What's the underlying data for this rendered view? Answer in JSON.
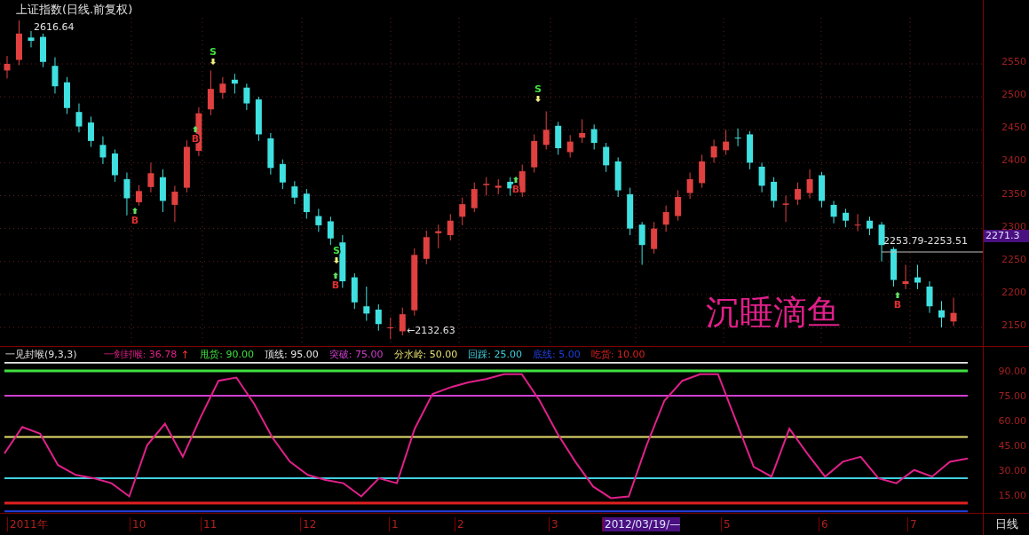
{
  "price_pane": {
    "title": "上证指数(日线.前复权)",
    "high_label": "2616.64",
    "low_label": "←2132.63",
    "range_label": "2253.79-2253.51",
    "signature": "沉睡滴鱼",
    "markers": [
      {
        "kind": "buy",
        "label": "B"
      },
      {
        "kind": "buy",
        "label": "B"
      },
      {
        "kind": "sell",
        "label": "S"
      },
      {
        "kind": "sell",
        "label": "S"
      },
      {
        "kind": "buy",
        "label": "B"
      },
      {
        "kind": "buy",
        "label": "B"
      },
      {
        "kind": "sell",
        "label": "S"
      },
      {
        "kind": "buy",
        "label": "B"
      }
    ],
    "current_price": "2271.3",
    "chart_data": {
      "type": "candlestick",
      "grid": true,
      "ylim": [
        2121.72,
        2646.97
      ],
      "categories": [
        null,
        null,
        null,
        null,
        null,
        null,
        null,
        null,
        null,
        null,
        null,
        null,
        null,
        null,
        null,
        null,
        null,
        null,
        null,
        null,
        null,
        null,
        null,
        null,
        null,
        null,
        null,
        null,
        null,
        null,
        null,
        null,
        null,
        null,
        null,
        null,
        null,
        null,
        null,
        null,
        null,
        null,
        null,
        null,
        null,
        null,
        null,
        null,
        null,
        null,
        null,
        null,
        null,
        null,
        null,
        null,
        null,
        null,
        null,
        null,
        null,
        null,
        null,
        null,
        null,
        null,
        null,
        null,
        null,
        null,
        null,
        null,
        null,
        null,
        null,
        null,
        null,
        null,
        null,
        null
      ],
      "yticks": [
        {
          "value": 2550,
          "label": "2550"
        },
        {
          "value": 2500,
          "label": "2500"
        },
        {
          "value": 2450,
          "label": "2450"
        },
        {
          "value": 2400,
          "label": "2400"
        },
        {
          "value": 2350,
          "label": "2350"
        },
        {
          "value": 2300,
          "label": "2300"
        },
        {
          "value": 2250,
          "label": "2250"
        },
        {
          "value": 2200,
          "label": "2200"
        },
        {
          "value": 2150,
          "label": "2150"
        }
      ],
      "ohlc": [
        [
          2540,
          2562,
          2528,
          2550
        ],
        [
          2556,
          2616,
          2548,
          2596
        ],
        [
          2590,
          2600,
          2575,
          2585
        ],
        [
          2591,
          2596,
          2545,
          2553
        ],
        [
          2547,
          2560,
          2505,
          2516
        ],
        [
          2522,
          2530,
          2474,
          2483
        ],
        [
          2477,
          2490,
          2446,
          2455
        ],
        [
          2461,
          2470,
          2424,
          2433
        ],
        [
          2427,
          2440,
          2398,
          2408
        ],
        [
          2414,
          2420,
          2371,
          2381
        ],
        [
          2375,
          2385,
          2320,
          2346
        ],
        [
          2340,
          2366,
          2335,
          2357
        ],
        [
          2363,
          2400,
          2355,
          2384
        ],
        [
          2378,
          2390,
          2325,
          2342
        ],
        [
          2336,
          2365,
          2310,
          2356
        ],
        [
          2362,
          2434,
          2355,
          2424
        ],
        [
          2418,
          2484,
          2410,
          2475
        ],
        [
          2481,
          2540,
          2472,
          2512
        ],
        [
          2506,
          2530,
          2497,
          2520
        ],
        [
          2526,
          2535,
          2505,
          2520
        ],
        [
          2514,
          2520,
          2480,
          2490
        ],
        [
          2496,
          2500,
          2433,
          2443
        ],
        [
          2437,
          2445,
          2382,
          2392
        ],
        [
          2398,
          2405,
          2360,
          2370
        ],
        [
          2364,
          2372,
          2337,
          2347
        ],
        [
          2353,
          2360,
          2315,
          2325
        ],
        [
          2319,
          2330,
          2295,
          2305
        ],
        [
          2311,
          2318,
          2275,
          2285
        ],
        [
          2279,
          2290,
          2210,
          2220
        ],
        [
          2226,
          2232,
          2178,
          2188
        ],
        [
          2182,
          2212,
          2160,
          2171
        ],
        [
          2177,
          2185,
          2145,
          2155
        ],
        [
          2149,
          2165,
          2132,
          2150
        ],
        [
          2144,
          2180,
          2138,
          2170
        ],
        [
          2176,
          2270,
          2168,
          2260
        ],
        [
          2254,
          2297,
          2246,
          2287
        ],
        [
          2293,
          2306,
          2270,
          2296
        ],
        [
          2290,
          2322,
          2282,
          2312
        ],
        [
          2318,
          2347,
          2305,
          2337
        ],
        [
          2331,
          2370,
          2325,
          2360
        ],
        [
          2366,
          2378,
          2350,
          2368
        ],
        [
          2362,
          2375,
          2352,
          2365
        ],
        [
          2371,
          2378,
          2350,
          2361
        ],
        [
          2355,
          2397,
          2348,
          2387
        ],
        [
          2393,
          2443,
          2385,
          2433
        ],
        [
          2427,
          2478,
          2420,
          2450
        ],
        [
          2456,
          2462,
          2412,
          2422
        ],
        [
          2416,
          2442,
          2408,
          2432
        ],
        [
          2438,
          2466,
          2430,
          2445
        ],
        [
          2451,
          2458,
          2420,
          2430
        ],
        [
          2424,
          2430,
          2386,
          2396
        ],
        [
          2402,
          2408,
          2348,
          2358
        ],
        [
          2352,
          2362,
          2290,
          2300
        ],
        [
          2306,
          2310,
          2245,
          2275
        ],
        [
          2269,
          2310,
          2262,
          2300
        ],
        [
          2306,
          2335,
          2295,
          2325
        ],
        [
          2319,
          2358,
          2312,
          2348
        ],
        [
          2354,
          2385,
          2345,
          2375
        ],
        [
          2369,
          2412,
          2362,
          2402
        ],
        [
          2408,
          2435,
          2400,
          2425
        ],
        [
          2419,
          2450,
          2412,
          2432
        ],
        [
          2438,
          2452,
          2425,
          2437
        ],
        [
          2443,
          2448,
          2390,
          2400
        ],
        [
          2394,
          2400,
          2355,
          2365
        ],
        [
          2371,
          2378,
          2332,
          2342
        ],
        [
          2336,
          2350,
          2310,
          2338
        ],
        [
          2344,
          2370,
          2336,
          2360
        ],
        [
          2354,
          2390,
          2346,
          2375
        ],
        [
          2381,
          2386,
          2332,
          2342
        ],
        [
          2336,
          2342,
          2308,
          2318
        ],
        [
          2324,
          2330,
          2302,
          2312
        ],
        [
          2306,
          2322,
          2296,
          2306
        ],
        [
          2312,
          2318,
          2290,
          2300
        ],
        [
          2306,
          2310,
          2250,
          2275
        ],
        [
          2269,
          2272,
          2212,
          2222
        ],
        [
          2216,
          2245,
          2208,
          2220
        ],
        [
          2226,
          2245,
          2208,
          2218
        ],
        [
          2212,
          2220,
          2172,
          2182
        ],
        [
          2176,
          2190,
          2150,
          2165
        ],
        [
          2159,
          2195,
          2152,
          2172
        ]
      ]
    }
  },
  "indicator_pane": {
    "title": "一见封喉(9,3,3)",
    "legend": [
      {
        "kind": "line",
        "value": "36.78",
        "arrow": "↑"
      },
      {
        "kind": "level",
        "value": "90.00"
      },
      {
        "kind": "level",
        "value": "95.00"
      },
      {
        "kind": "level",
        "value": "75.00"
      },
      {
        "kind": "level",
        "value": "50.00"
      },
      {
        "kind": "level",
        "value": "25.00"
      },
      {
        "kind": "level",
        "value": "5.00"
      },
      {
        "kind": "level",
        "value": "10.00"
      }
    ],
    "chart_data": {
      "type": "line",
      "ylim": [
        4.09,
        95.37
      ],
      "yticks": [
        {
          "value": 90,
          "label": "90.00"
        },
        {
          "value": 75,
          "label": "75.00"
        },
        {
          "value": 60,
          "label": "60.00"
        },
        {
          "value": 45,
          "label": "45.00"
        },
        {
          "value": 30,
          "label": "30.00"
        },
        {
          "value": 15,
          "label": "15.00"
        }
      ],
      "series": [
        {
          "name": "一剑封喉:",
          "color": "#e0208a",
          "values": [
            40,
            56,
            52,
            33,
            27,
            25,
            22,
            14,
            45,
            58,
            38,
            62,
            84,
            86,
            70,
            50,
            35,
            27,
            24,
            22,
            14,
            25,
            22,
            55,
            76,
            80,
            83,
            85,
            88,
            88,
            72,
            52,
            35,
            20,
            13,
            14,
            45,
            72,
            84,
            88,
            88,
            60,
            32,
            26,
            55,
            40,
            26,
            35,
            38,
            25,
            22,
            30,
            26,
            35,
            37
          ]
        },
        {
          "name": "甩货:",
          "color": "#40e040",
          "values": [
            90,
            90,
            90,
            90,
            90,
            90,
            90,
            90,
            90,
            90,
            90,
            90,
            90,
            90,
            90,
            90,
            90,
            90,
            90,
            90,
            90,
            90,
            90,
            90,
            90,
            90,
            90,
            90,
            90,
            90,
            90,
            90,
            90,
            90,
            90,
            90,
            90,
            90,
            90,
            90,
            90,
            90,
            90,
            90,
            90,
            90,
            90,
            90,
            90,
            90,
            90,
            90,
            90,
            90,
            90
          ]
        },
        {
          "name": "顶线:",
          "color": "#e8e8e8",
          "values": [
            95,
            95,
            95,
            95,
            95,
            95,
            95,
            95,
            95,
            95,
            95,
            95,
            95,
            95,
            95,
            95,
            95,
            95,
            95,
            95,
            95,
            95,
            95,
            95,
            95,
            95,
            95,
            95,
            95,
            95,
            95,
            95,
            95,
            95,
            95,
            95,
            95,
            95,
            95,
            95,
            95,
            95,
            95,
            95,
            95,
            95,
            95,
            95,
            95,
            95,
            95,
            95,
            95,
            95,
            95
          ]
        },
        {
          "name": "突破:",
          "color": "#d040d0",
          "values": [
            75,
            75,
            75,
            75,
            75,
            75,
            75,
            75,
            75,
            75,
            75,
            75,
            75,
            75,
            75,
            75,
            75,
            75,
            75,
            75,
            75,
            75,
            75,
            75,
            75,
            75,
            75,
            75,
            75,
            75,
            75,
            75,
            75,
            75,
            75,
            75,
            75,
            75,
            75,
            75,
            75,
            75,
            75,
            75,
            75,
            75,
            75,
            75,
            75,
            75,
            75,
            75,
            75,
            75,
            75
          ]
        },
        {
          "name": "分水岭:",
          "color": "#e8e070",
          "values": [
            50,
            50,
            50,
            50,
            50,
            50,
            50,
            50,
            50,
            50,
            50,
            50,
            50,
            50,
            50,
            50,
            50,
            50,
            50,
            50,
            50,
            50,
            50,
            50,
            50,
            50,
            50,
            50,
            50,
            50,
            50,
            50,
            50,
            50,
            50,
            50,
            50,
            50,
            50,
            50,
            50,
            50,
            50,
            50,
            50,
            50,
            50,
            50,
            50,
            50,
            50,
            50,
            50,
            50,
            50
          ]
        },
        {
          "name": "回踩:",
          "color": "#40d0e0",
          "values": [
            25,
            25,
            25,
            25,
            25,
            25,
            25,
            25,
            25,
            25,
            25,
            25,
            25,
            25,
            25,
            25,
            25,
            25,
            25,
            25,
            25,
            25,
            25,
            25,
            25,
            25,
            25,
            25,
            25,
            25,
            25,
            25,
            25,
            25,
            25,
            25,
            25,
            25,
            25,
            25,
            25,
            25,
            25,
            25,
            25,
            25,
            25,
            25,
            25,
            25,
            25,
            25,
            25,
            25,
            25
          ]
        },
        {
          "name": "底线:",
          "color": "#2040e0",
          "values": [
            5,
            5,
            5,
            5,
            5,
            5,
            5,
            5,
            5,
            5,
            5,
            5,
            5,
            5,
            5,
            5,
            5,
            5,
            5,
            5,
            5,
            5,
            5,
            5,
            5,
            5,
            5,
            5,
            5,
            5,
            5,
            5,
            5,
            5,
            5,
            5,
            5,
            5,
            5,
            5,
            5,
            5,
            5,
            5,
            5,
            5,
            5,
            5,
            5,
            5,
            5,
            5,
            5,
            5,
            5
          ]
        },
        {
          "name": "吃货:",
          "color": "#e02020",
          "values": [
            10,
            10,
            10,
            10,
            10,
            10,
            10,
            10,
            10,
            10,
            10,
            10,
            10,
            10,
            10,
            10,
            10,
            10,
            10,
            10,
            10,
            10,
            10,
            10,
            10,
            10,
            10,
            10,
            10,
            10,
            10,
            10,
            10,
            10,
            10,
            10,
            10,
            10,
            10,
            10,
            10,
            10,
            10,
            10,
            10,
            10,
            10,
            10,
            10,
            10,
            10,
            10,
            10,
            10,
            10
          ]
        }
      ]
    }
  },
  "time_axis": {
    "labels": [
      {
        "text": "2011年",
        "selected": false
      },
      {
        "text": "10",
        "selected": false
      },
      {
        "text": "11",
        "selected": false
      },
      {
        "text": "12",
        "selected": false
      },
      {
        "text": "1",
        "selected": false
      },
      {
        "text": "2",
        "selected": false
      },
      {
        "text": "3",
        "selected": false
      },
      {
        "text": "2012/03/19/—",
        "selected": true
      },
      {
        "text": "5",
        "selected": false
      },
      {
        "text": "6",
        "selected": false
      },
      {
        "text": "7",
        "selected": false
      }
    ],
    "period": "日线"
  }
}
